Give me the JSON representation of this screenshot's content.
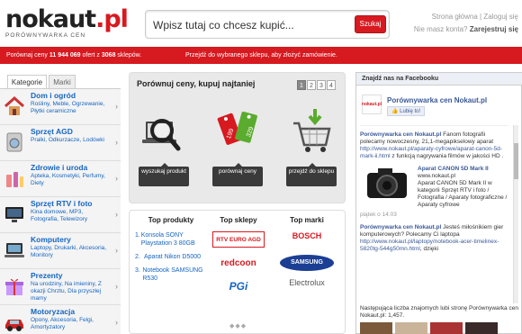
{
  "header": {
    "logo_main": "nokaut",
    "logo_ext": ".pl",
    "tagline": "PORÓWNYWARKA CEN",
    "search_placeholder": "Wpisz tutaj co chcesz kupić...",
    "search_button": "Szukaj",
    "account_link": "Strona główna | Zaloguj się",
    "account_question": "Nie masz konta?",
    "register_link": "Zarejestruj się"
  },
  "promo_bar": {
    "prefix": "Porównaj ceny",
    "offers_count": "11 944 069",
    "middle": "ofert z",
    "shops_count": "3068",
    "suffix": "sklepów.",
    "right_text": "Przejdź do wybranego sklepu, aby złożyć zamówienie."
  },
  "sidebar": {
    "tabs": [
      "Kategorie",
      "Marki"
    ],
    "categories": [
      {
        "title": "Dom i ogród",
        "desc": "Rośliny, Meble, Ogrzewanie, Płytki ceramiczne",
        "icon": "house-icon"
      },
      {
        "title": "Sprzęt AGD",
        "desc": "Pralki, Odkurzacze, Lodówki",
        "icon": "appliance-icon"
      },
      {
        "title": "Zdrowie i uroda",
        "desc": "Apteka, Kosmetyki, Perfumy, Diety",
        "icon": "cosmetics-icon"
      },
      {
        "title": "Sprzęt RTV i foto",
        "desc": "Kina domowe, MP3, Fotografia, Telewizory",
        "icon": "tv-icon"
      },
      {
        "title": "Komputery",
        "desc": "Laptopy, Drukarki, Akcesoria, Monitory",
        "icon": "computer-icon"
      },
      {
        "title": "Prezenty",
        "desc": "Na urodziny, Na imieniny, Z okazji Chrztu, Dla przyszłej mamy",
        "icon": "gift-icon"
      },
      {
        "title": "Motoryzacja",
        "desc": "Opony, Akcesoria, Felgi, Amortyzatory",
        "icon": "car-icon"
      }
    ]
  },
  "promo": {
    "title": "Porównuj ceny, kupuj najtaniej",
    "pages": [
      "1",
      "2",
      "3",
      "4"
    ],
    "steps": [
      {
        "label": "wyszukaj produkt"
      },
      {
        "label": "porównaj ceny"
      },
      {
        "label": "przejdź do sklepu"
      }
    ],
    "tag_prices": [
      "199",
      "329"
    ]
  },
  "tops": {
    "products_title": "Top produkty",
    "shops_title": "Top sklepy",
    "brands_title": "Top marki",
    "products": [
      {
        "n": "1.",
        "name": "Konsola SONY Playstation 3 80GB"
      },
      {
        "n": "2.",
        "name": "Aparat Nikon D5000"
      },
      {
        "n": "3.",
        "name": "Notebook SAMSUNG R530"
      }
    ],
    "shops": [
      "RTV EURO AGD",
      "redcoon",
      "PGi"
    ],
    "brands": [
      "BOSCH",
      "SAMSUNG",
      "Electrolux"
    ]
  },
  "facebook": {
    "header": "Znajdź nas na Facebooku",
    "page_name": "Porównywarka cen Nokaut.pl",
    "like_button": "Lubię to!",
    "avatar_text": "nokaut.pl",
    "posts": [
      {
        "name": "Porównywarka cen Nokaut.pl",
        "text": "Fanom fotografii polecamy nowoczesny, 21,1-megapikselowy aparat",
        "link": "http://www.nokaut.pl/aparaty-cyfrowe/aparat-canon-5d-mark-ii.html",
        "tail": "z funkcją nagrywania filmów w jakości HD ."
      },
      {
        "cam_title": "Aparat CANON 5D Mark II",
        "cam_url": "www.nokaut.pl",
        "cam_desc": "Aparat CANON 5D Mark II w kategorii Sprzęt RTV i foto / Fotografia / Aparaty fotograficzne / Aparaty cyfrowe",
        "time": "piątek o 14:03"
      },
      {
        "name": "Porównywarka cen Nokaut.pl",
        "text": "Jesteś miłośnikiem gier komputerowych? Polecamy Ci laptopa",
        "link": "http://www.nokaut.pl/laptopy/notebook-acer-timelinex-5820tg-544g50mn.html",
        "tail": ", dzięki"
      }
    ],
    "fans_text": "Następująca liczba znajomych lubi stronę Porównywarka cen Nokaut.pl: 1,457."
  }
}
